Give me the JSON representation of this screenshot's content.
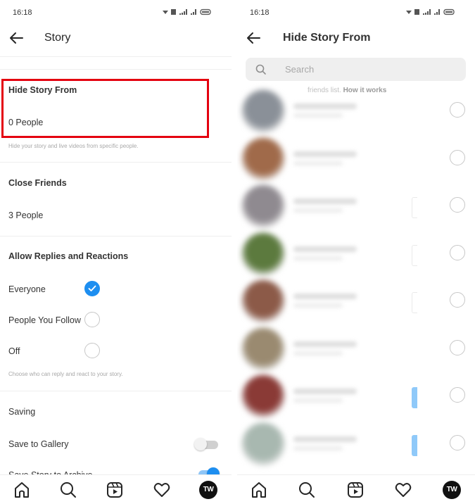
{
  "left_screen": {
    "status_bar": {
      "time": "16:18",
      "icons": "wifi-icon signal-icon battery-icon",
      "icons_text": "▾ 𝟚𝟚 .ıl .ıl ▭"
    },
    "header": {
      "back_icon": "arrow-left-icon",
      "title": "Story"
    },
    "hide_story": {
      "title": "Hide Story From",
      "value": "0 People",
      "hint": "Hide your story and live videos from specific people.",
      "highlight_color": "#e4000f"
    },
    "close_friends": {
      "title": "Close Friends",
      "value": "3 People"
    },
    "replies": {
      "title": "Allow Replies and Reactions",
      "options": [
        {
          "label": "Everyone",
          "selected": true
        },
        {
          "label": "People You Follow",
          "selected": false
        },
        {
          "label": "Off",
          "selected": false
        }
      ],
      "hint": "Choose who can reply and react to your story."
    },
    "saving": {
      "title": "Saving",
      "items": [
        {
          "label": "Save to Gallery",
          "on": false
        },
        {
          "label": "Save Story to Archive",
          "on": true
        }
      ]
    }
  },
  "right_screen": {
    "status_bar": {
      "time": "16:18"
    },
    "header": {
      "back_icon": "arrow-left-icon",
      "title": "Hide Story From"
    },
    "search": {
      "placeholder": "Search",
      "value": ""
    },
    "faded_note": {
      "text": "friends list.",
      "link": "How it works"
    },
    "users": [
      {
        "avatar_color": "#8a9098",
        "selected": false,
        "tag": "none"
      },
      {
        "avatar_color": "#a06a4a",
        "selected": false,
        "tag": "none"
      },
      {
        "avatar_color": "#8f8a90",
        "selected": false,
        "tag": "outline"
      },
      {
        "avatar_color": "#5c7a3e",
        "selected": false,
        "tag": "outline"
      },
      {
        "avatar_color": "#8c5a48",
        "selected": false,
        "tag": "outline"
      },
      {
        "avatar_color": "#9a8a70",
        "selected": false,
        "tag": "none"
      },
      {
        "avatar_color": "#8a3a36",
        "selected": false,
        "tag": "blue"
      },
      {
        "avatar_color": "#a8b8b0",
        "selected": false,
        "tag": "blue"
      }
    ]
  },
  "bottom_nav": {
    "items": [
      "home-icon",
      "search-icon",
      "reels-icon",
      "heart-icon",
      "profile-avatar"
    ],
    "profile_initials": "TW"
  },
  "colors": {
    "accent": "#1d8ef0",
    "highlight": "#e4000f"
  }
}
